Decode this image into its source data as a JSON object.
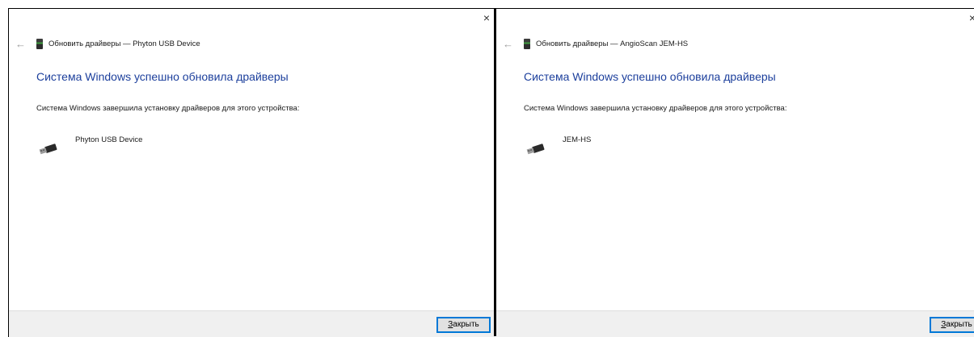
{
  "left_window": {
    "title": "Обновить драйверы — Phyton USB Device",
    "headline": "Система Windows успешно обновила драйверы",
    "message": "Система Windows завершила установку драйверов для этого устройства:",
    "device_name": "Phyton USB Device",
    "close_button_accel": "З",
    "close_button_rest": "акрыть",
    "close_glyph": "×"
  },
  "right_window": {
    "title": "Обновить драйверы — AngioScan JEM-HS",
    "headline": "Система Windows успешно обновила драйверы",
    "message": "Система Windows завершила установку драйверов для этого устройства:",
    "device_name": "JEM-HS",
    "close_button_accel": "З",
    "close_button_rest": "акрыть",
    "close_glyph": "×"
  },
  "icons": {
    "back": "back-arrow-icon",
    "device": "usb-device-icon",
    "usb": "usb-connector-icon",
    "close": "close-icon"
  },
  "colors": {
    "headline": "#1c3f9c",
    "footer": "#f0f0f0",
    "button_border": "#0078d7"
  }
}
